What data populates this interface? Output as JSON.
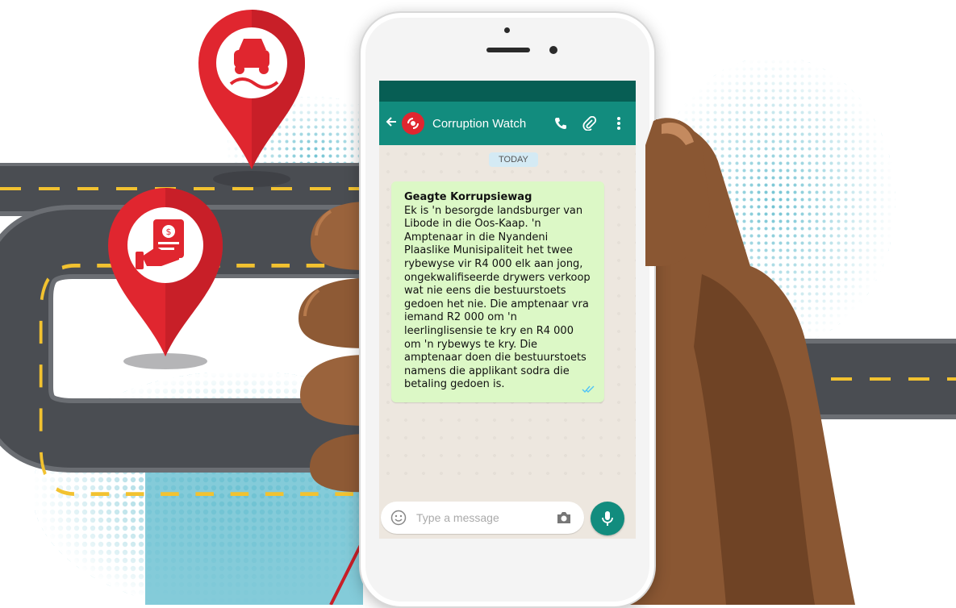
{
  "app": {
    "contact_name": "Corruption Watch",
    "date_chip": "TODAY"
  },
  "message": {
    "title": "Geagte Korrupsiewag",
    "body": "Ek is 'n besorgde landsburger van Libode in die Oos-Kaap. 'n Amptenaar in die Nyandeni Plaaslike Munisipaliteit het twee rybewyse vir R4 000 elk aan jong, ongekwalifiseerde drywers verkoop wat nie eens die bestuurstoets gedoen het nie. Die amptenaar vra iemand R2 000 om 'n leerlinglisensie te kry en R4 000 om 'n rybewys te kry. Die amptenaar doen die bestuurstoets namens die applikant sodra die betaling gedoen is.",
    "status_icon": "double-check-icon"
  },
  "input": {
    "placeholder": "Type a message"
  },
  "icons": {
    "back": "arrow-left-icon",
    "avatar": "corruption-watch-logo-icon",
    "call": "phone-icon",
    "attach": "paperclip-icon",
    "menu": "more-vert-icon",
    "emoji": "smiley-icon",
    "camera": "camera-icon",
    "mic": "microphone-icon",
    "pin_top": "car-skid-icon",
    "pin_bottom": "hand-document-money-icon"
  },
  "colors": {
    "accent_red": "#e0262f",
    "whatsapp_dark": "#075e54",
    "whatsapp_teal": "#128c7e",
    "bubble_green": "#dcf8c6",
    "chat_bg": "#ede7df",
    "road": "#4a4d52",
    "road_marking": "#f2c230",
    "halftone_blue": "#6fc2d2"
  }
}
